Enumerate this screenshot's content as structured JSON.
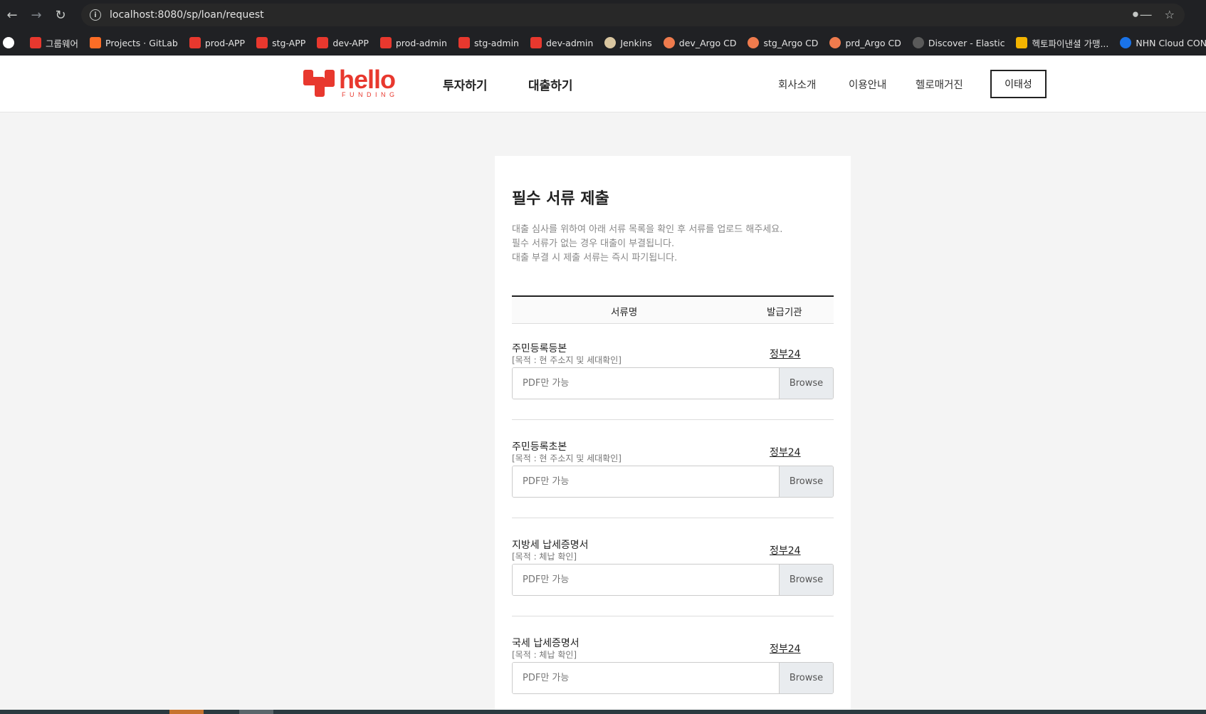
{
  "browser": {
    "url": "localhost:8080/sp/loan/request",
    "bookmarks": [
      {
        "label": "",
        "icon": "chatgpt-icon"
      },
      {
        "label": "그룹웨어",
        "icon": "hellofunding-icon"
      },
      {
        "label": "Projects · GitLab",
        "icon": "gitlab-icon"
      },
      {
        "label": "prod-APP",
        "icon": "hellofunding-icon"
      },
      {
        "label": "stg-APP",
        "icon": "hellofunding-icon"
      },
      {
        "label": "dev-APP",
        "icon": "hellofunding-icon"
      },
      {
        "label": "prod-admin",
        "icon": "hellofunding-icon"
      },
      {
        "label": "stg-admin",
        "icon": "hellofunding-icon"
      },
      {
        "label": "dev-admin",
        "icon": "hellofunding-icon"
      },
      {
        "label": "Jenkins",
        "icon": "jenkins-icon"
      },
      {
        "label": "dev_Argo CD",
        "icon": "argo-icon"
      },
      {
        "label": "stg_Argo CD",
        "icon": "argo-icon"
      },
      {
        "label": "prd_Argo CD",
        "icon": "argo-icon"
      },
      {
        "label": "Discover - Elastic",
        "icon": "elastic-icon"
      },
      {
        "label": "헥토파이낸셜 가맹...",
        "icon": "hecto-icon"
      },
      {
        "label": "NHN Cloud CONS...",
        "icon": "nhn-cloud-icon"
      }
    ]
  },
  "header": {
    "logo_main": "hello",
    "logo_sub": "FUNDING",
    "nav": [
      "투자하기",
      "대출하기"
    ],
    "sub_nav": [
      "회사소개",
      "이용안내",
      "헬로매거진"
    ],
    "user_name": "이태성"
  },
  "main": {
    "title": "필수 서류 제출",
    "description": [
      "대출 심사를 위하여 아래 서류 목록을 확인 후 서류를 업로드 해주세요.",
      "필수 서류가 없는 경우 대출이 부결됩니다.",
      "대출 부결 시 제출 서류는 즉시 파기됩니다."
    ],
    "table_headers": {
      "name": "서류명",
      "issuer": "발급기관"
    },
    "documents": [
      {
        "name": "주민등록등본",
        "purpose": "[목적 : 현 주소지 및 세대확인]",
        "issuer": "정부24",
        "placeholder": "PDF만 가능",
        "browse": "Browse"
      },
      {
        "name": "주민등록초본",
        "purpose": "[목적 : 현 주소지 및 세대확인]",
        "issuer": "정부24",
        "placeholder": "PDF만 가능",
        "browse": "Browse"
      },
      {
        "name": "지방세 납세증명서",
        "purpose": "[목적 : 체납 확인]",
        "issuer": "정부24",
        "placeholder": "PDF만 가능",
        "browse": "Browse"
      },
      {
        "name": "국세 납세증명서",
        "purpose": "[목적 : 체납 확인]",
        "issuer": "정부24",
        "placeholder": "PDF만 가능",
        "browse": "Browse"
      }
    ]
  },
  "colors": {
    "brand": "#e8382e",
    "chrome_bg": "#202124",
    "page_bg": "#f4f4f4"
  }
}
